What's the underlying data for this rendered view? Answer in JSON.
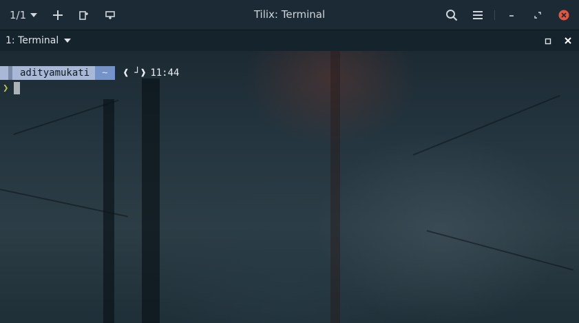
{
  "window": {
    "title": "Tilix: Terminal",
    "session_indicator": "1/1",
    "icons": {
      "add": "plus-icon",
      "split_right": "split-right-icon",
      "split_down": "split-down-icon",
      "search": "search-icon",
      "menu": "hamburger-menu-icon",
      "minimize": "minimize-icon",
      "maximize": "restore-icon",
      "close": "close-icon"
    },
    "close_color": "#e2563f"
  },
  "tab": {
    "label": "1: Terminal",
    "maximize_icon": "maximize-icon",
    "close_icon": "close-x-icon"
  },
  "terminal": {
    "user": "adityamukati",
    "dir": "~",
    "git": "❰ ┘❱",
    "time": "11:44",
    "prompt_symbol": "❯",
    "colors": {
      "user_bg": "#a9b8d6",
      "dir_bg": "#7693c9",
      "prompt_chevron": "#b6c35a"
    }
  }
}
